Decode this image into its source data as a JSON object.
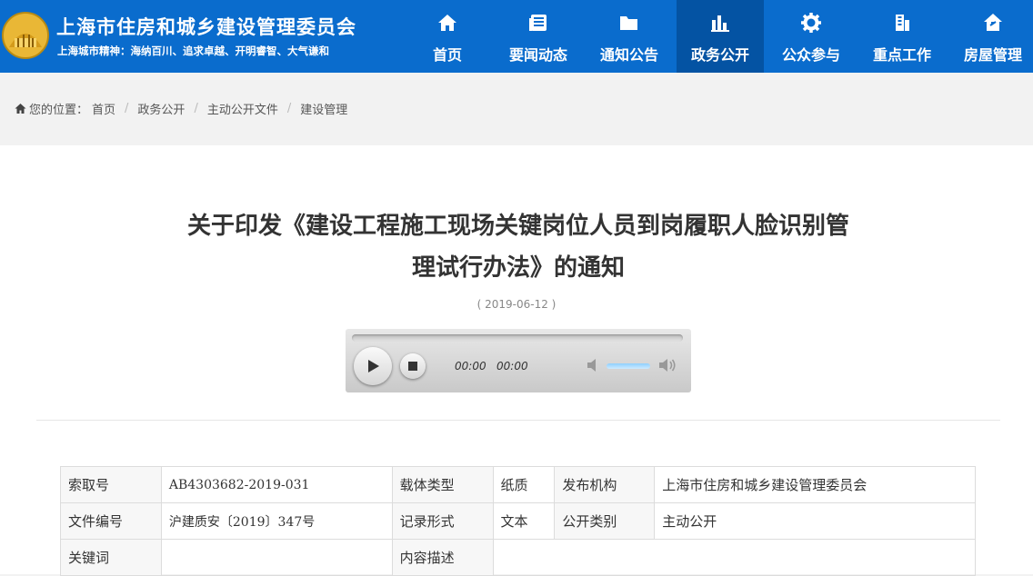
{
  "header": {
    "site_title": "上海市住房和城乡建设管理委员会",
    "motto": "上海城市精神：海纳百川、追求卓越、开明睿智、大气谦和",
    "logo_icon": "city-emblem-icon",
    "nav": [
      {
        "label": "首页",
        "icon": "home-icon"
      },
      {
        "label": "要闻动态",
        "icon": "news-icon"
      },
      {
        "label": "通知公告",
        "icon": "folder-icon"
      },
      {
        "label": "政务公开",
        "icon": "chart-icon",
        "active": true
      },
      {
        "label": "公众参与",
        "icon": "gear-icon"
      },
      {
        "label": "重点工作",
        "icon": "building-icon"
      },
      {
        "label": "房屋管理",
        "icon": "house-icon"
      }
    ]
  },
  "breadcrumb": {
    "prefix": "您的位置：",
    "items": [
      "首页",
      "政务公开",
      "主动公开文件",
      "建设管理"
    ]
  },
  "article": {
    "title_line1": "关于印发《建设工程施工现场关键岗位人员到岗履职人脸识别管",
    "title_line2": "理试行办法》的通知",
    "date": "( 2019-06-12 )"
  },
  "player": {
    "current_time": "00:00",
    "duration": "00:00",
    "volume": 1.0
  },
  "info": {
    "rows": [
      {
        "c1": "索取号",
        "c2": "AB4303682-2019-031",
        "c3": "载体类型",
        "c4": "纸质",
        "c5": "发布机构",
        "c6": "上海市住房和城乡建设管理委员会"
      },
      {
        "c1": "文件编号",
        "c2": "沪建质安〔2019〕347号",
        "c3": "记录形式",
        "c4": "文本",
        "c5": "公开类别",
        "c6": "主动公开"
      },
      {
        "c1": "关键词",
        "c2": "",
        "c3": "内容描述",
        "c4": ""
      }
    ]
  },
  "colors": {
    "header_blue": "#0a6ccd",
    "nav_active": "#0453a3"
  }
}
